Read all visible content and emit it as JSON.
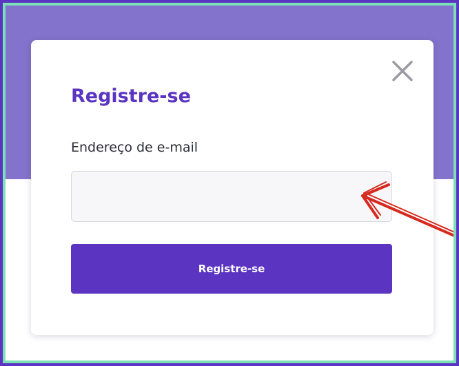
{
  "modal": {
    "title": "Registre-se",
    "email_label": "Endereço de e-mail",
    "email_value": "",
    "email_placeholder": "",
    "submit_label": "Registre-se",
    "close_icon": "close-icon"
  },
  "colors": {
    "accent": "#5b34c2",
    "hero_band": "#8473cc",
    "frame_border": "#7be0b8",
    "annotation_arrow": "#d62a1f"
  },
  "annotation": {
    "type": "hand-drawn-arrow",
    "points_to": "email-input"
  }
}
